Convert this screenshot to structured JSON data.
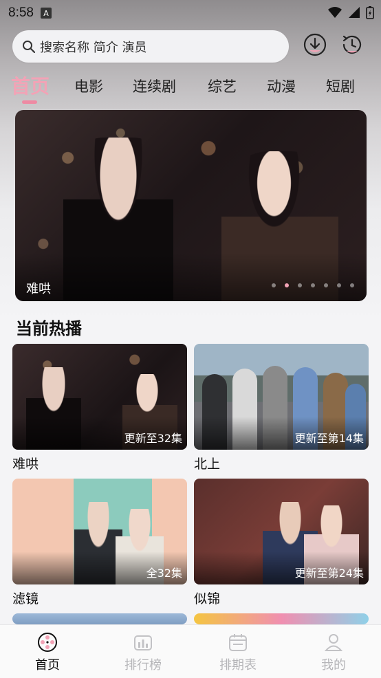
{
  "status": {
    "time": "8:58",
    "notif_glyph": "A"
  },
  "search": {
    "placeholder": "搜索名称 简介 演员"
  },
  "tabs": [
    {
      "label": "首页",
      "active": true
    },
    {
      "label": "电影"
    },
    {
      "label": "连续剧"
    },
    {
      "label": "综艺"
    },
    {
      "label": "动漫"
    },
    {
      "label": "短剧"
    }
  ],
  "banner": {
    "title": "难哄",
    "dot_count": 7,
    "active_dot_index": 1
  },
  "section": {
    "title": "当前热播"
  },
  "cards": [
    {
      "title": "难哄",
      "badge": "更新至32集"
    },
    {
      "title": "北上",
      "badge": "更新至第14集"
    },
    {
      "title": "滤镜",
      "badge": "全32集"
    },
    {
      "title": "似锦",
      "badge": "更新至第24集"
    }
  ],
  "bottom_nav": [
    {
      "label": "首页",
      "icon": "film-reel-icon",
      "active": true
    },
    {
      "label": "排行榜",
      "icon": "ranking-icon"
    },
    {
      "label": "排期表",
      "icon": "calendar-icon"
    },
    {
      "label": "我的",
      "icon": "profile-icon"
    }
  ],
  "colors": {
    "accent": "#f2a3b6"
  }
}
